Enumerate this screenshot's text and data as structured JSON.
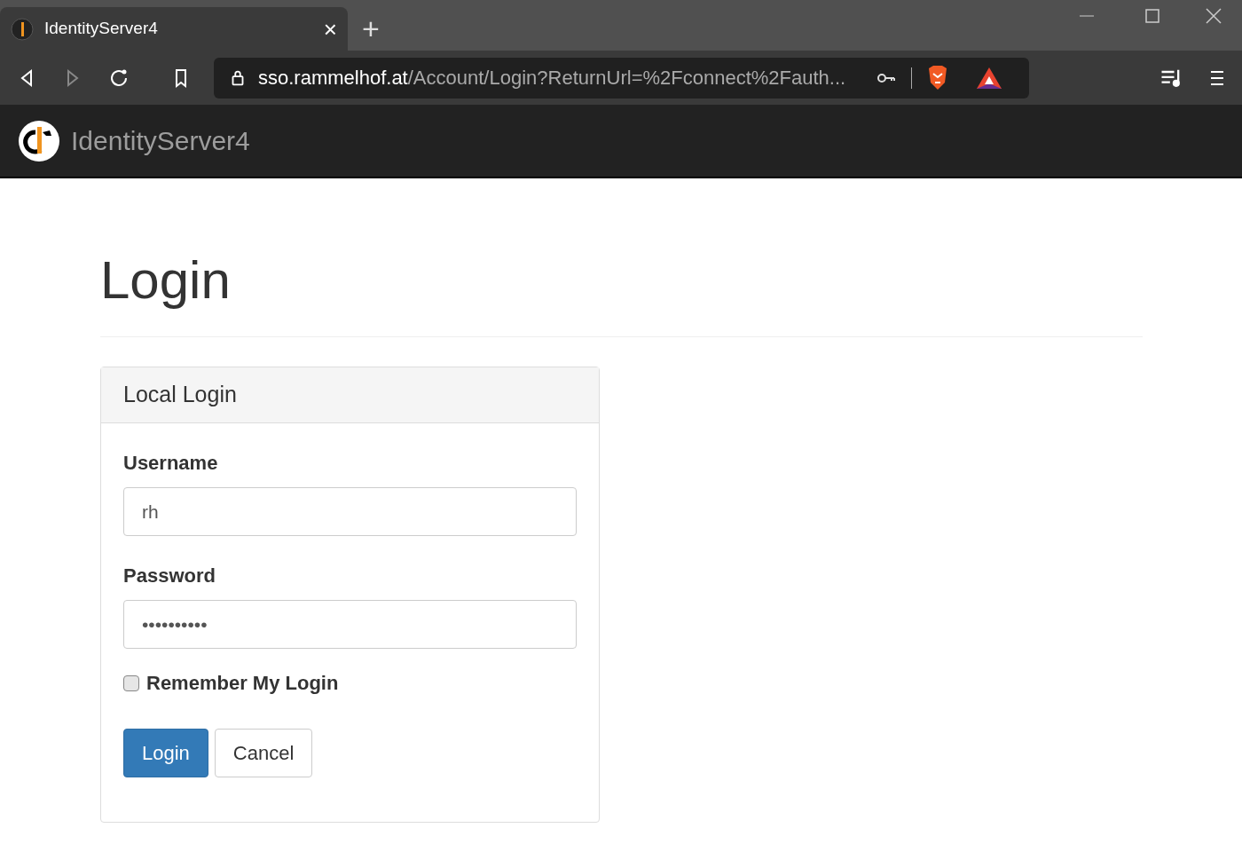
{
  "browser": {
    "tab": {
      "title": "IdentityServer4",
      "close": "×"
    },
    "new_tab": "+",
    "url_host": "sso.rammelhof.at",
    "url_path": "/Account/Login?ReturnUrl=%2Fconnect%2Fauth..."
  },
  "navbar": {
    "brand": "IdentityServer4"
  },
  "page": {
    "title": "Login"
  },
  "panel": {
    "heading": "Local Login",
    "fields": [
      {
        "label": "Username",
        "value": "rh"
      },
      {
        "label": "Password",
        "value": "••••••••••"
      }
    ],
    "remember": {
      "label": "Remember My Login",
      "checked": false
    },
    "buttons": [
      {
        "label": "Login",
        "kind": "primary"
      },
      {
        "label": "Cancel",
        "kind": "default"
      }
    ]
  }
}
